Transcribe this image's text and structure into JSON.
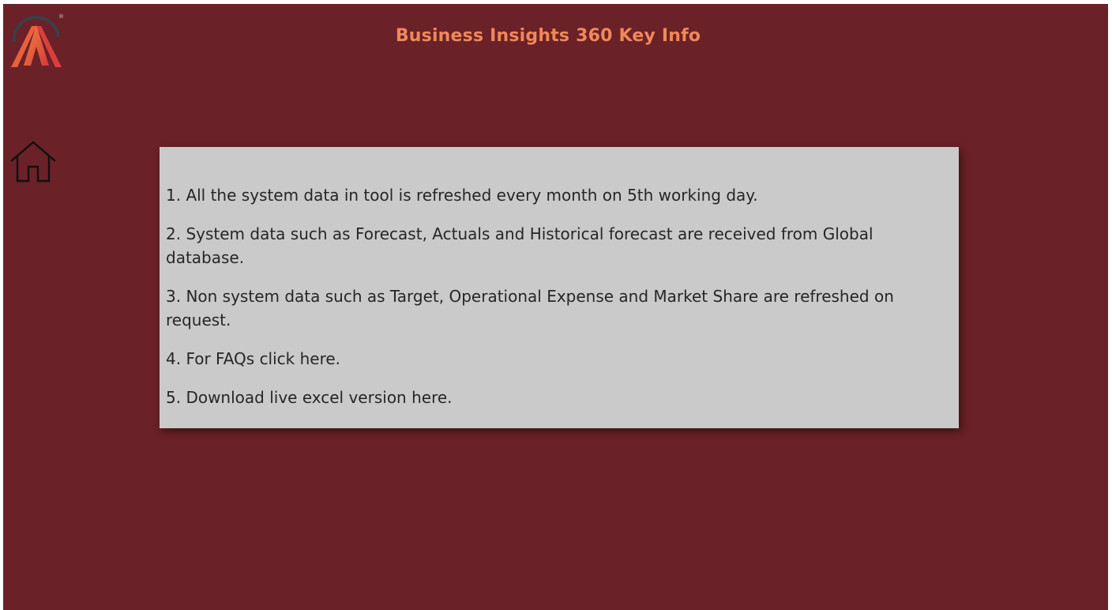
{
  "header": {
    "title": "Business Insights 360 Key Info",
    "logo_icon": "atliq-logo-icon",
    "registered_mark": "®"
  },
  "nav": {
    "home_icon": "home-icon"
  },
  "info": {
    "items": [
      "1. All the system data in tool is refreshed every month on 5th working day.",
      "2.  System data such as Forecast, Actuals and Historical forecast are received from Global database.",
      "3.  Non system data such as Target, Operational Expense and Market Share are refreshed on request.",
      "4. For FAQs click here.",
      "5. Download live excel version here."
    ]
  },
  "colors": {
    "background": "#6a2127",
    "title": "#f0885a",
    "panel": "#cacaca",
    "text": "#262626"
  }
}
